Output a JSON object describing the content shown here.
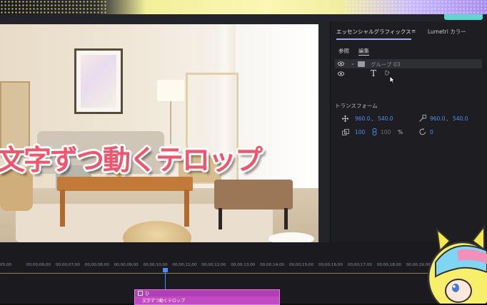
{
  "panel": {
    "tab_essential": "エッセンシャルグラフィックス",
    "tab_menu": "≡",
    "tab_lumetri": "Lumetri カラー",
    "subtab_browse": "参照",
    "subtab_edit": "編集",
    "layers": {
      "group_label": "グループ 03",
      "text_label": "ひ"
    },
    "transform": {
      "title": "トランスフォーム",
      "position_x": "960.0",
      "position_sep": ",",
      "position_y": "540.0",
      "anchor_x": "960.0",
      "anchor_sep": ",",
      "anchor_y": "540.0",
      "scale": "100",
      "scale_width": "100",
      "scale_unit": "%",
      "rotation": "0"
    }
  },
  "viewer": {
    "telop_text": "文字ずつ動くテロップ"
  },
  "timeline": {
    "ticks": [
      "05;00",
      "00;00;06;00",
      "00;00;07;00",
      "00;00;08;00",
      "00;00;09;00",
      "00;00;10;00",
      "00;00;11;00",
      "00;00;12;00",
      "00;00;13;00",
      "00;00;14;00",
      "00;00;15;00",
      "00;00;16;00",
      "00;00;17;00",
      "00;00;18;00",
      "00;00;19;00",
      "00"
    ],
    "clip_top": "ひ",
    "clip_name": "文字ずつ動くテロップ"
  },
  "colors": {
    "accent_blue": "#4a90ff",
    "clip_magenta": "#c24ac3",
    "telop_pink": "#f2556b"
  }
}
